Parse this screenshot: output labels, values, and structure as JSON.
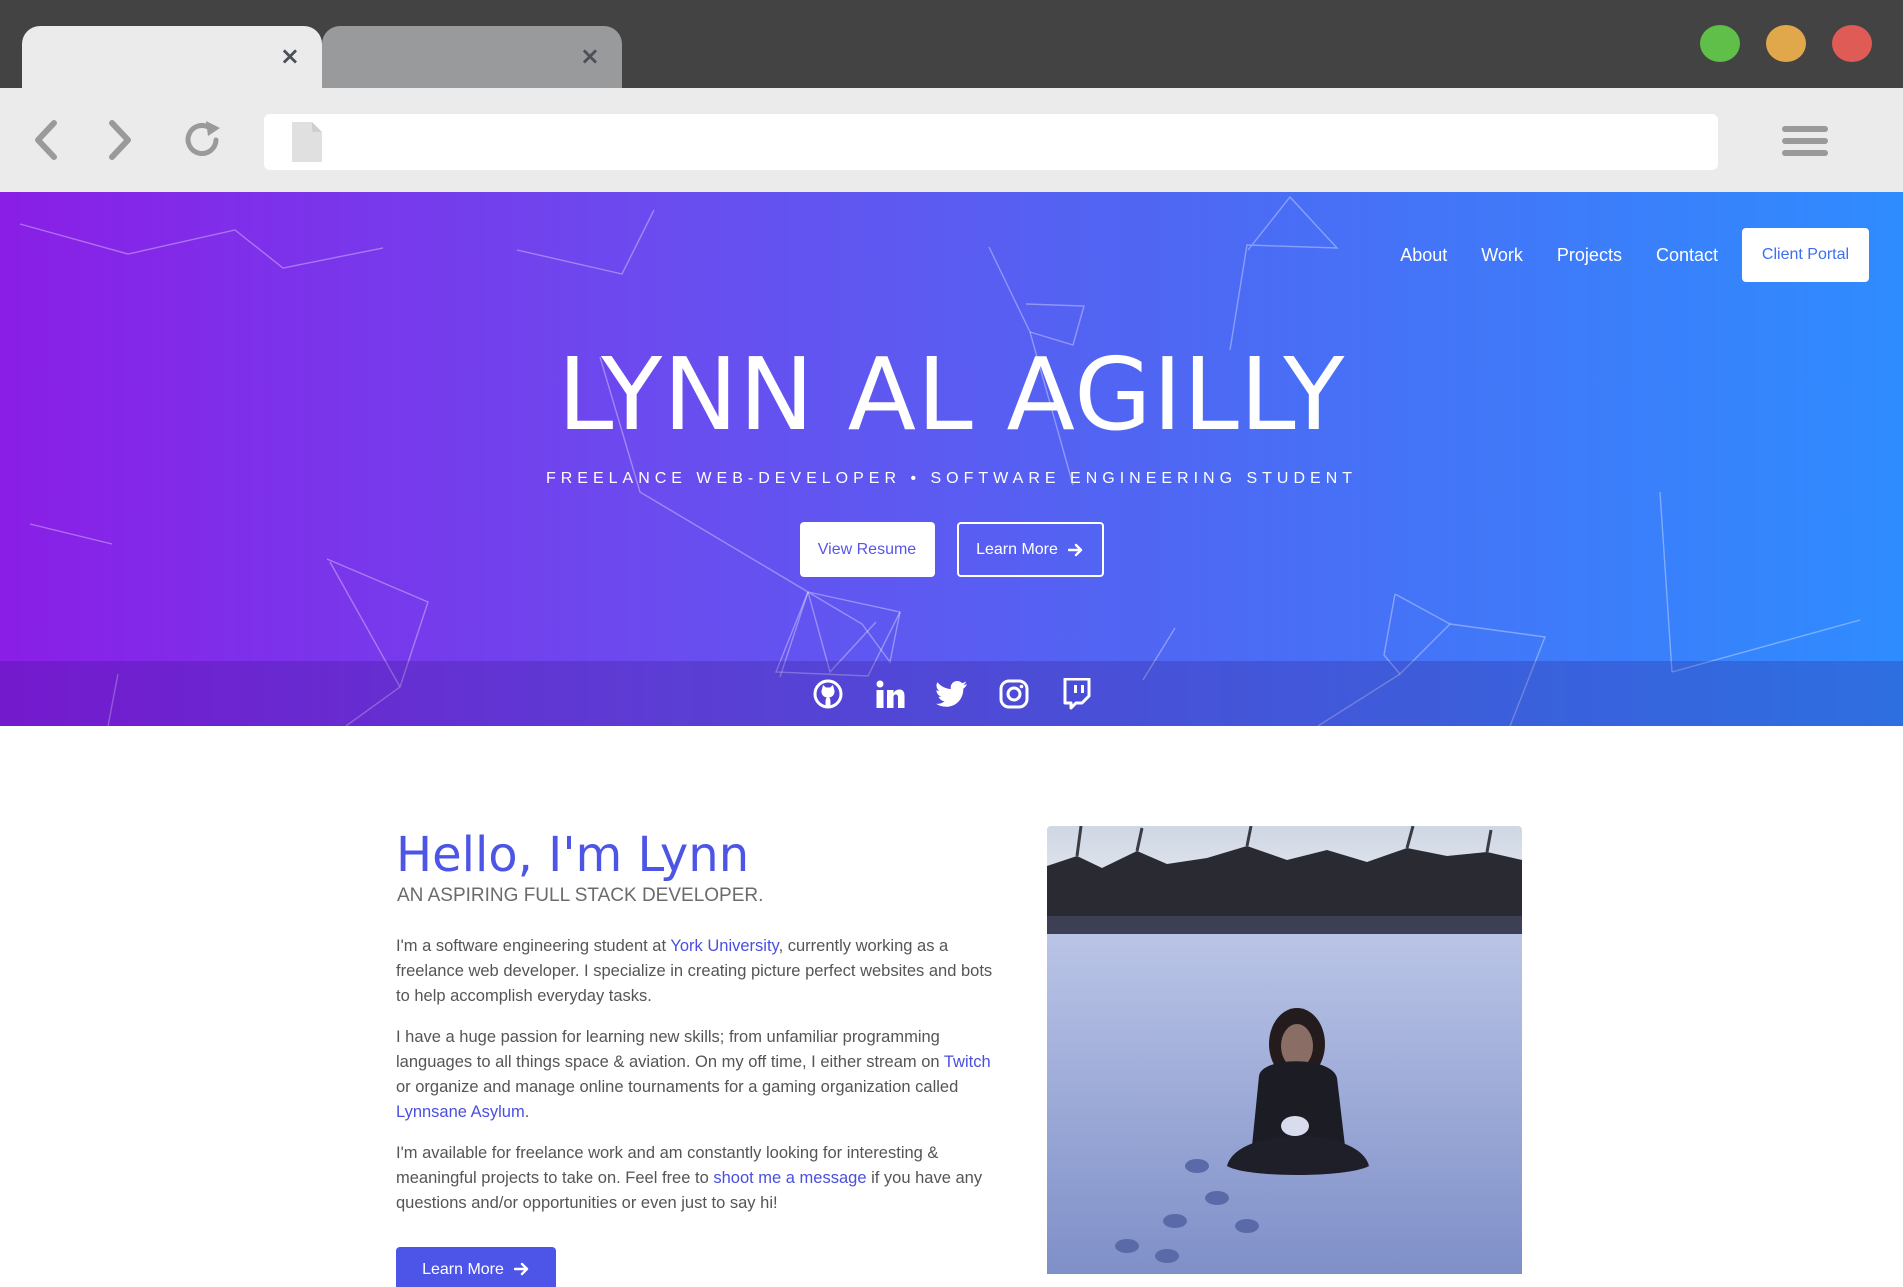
{
  "window": {
    "controls": [
      {
        "name": "maximize",
        "color": "#5fbf48"
      },
      {
        "name": "minimize",
        "color": "#e0a84a"
      },
      {
        "name": "close",
        "color": "#df5b55"
      }
    ]
  },
  "tabs": [
    {
      "state": "active",
      "close_icon": "×"
    },
    {
      "state": "inactive",
      "close_icon": "×"
    }
  ],
  "toolbar": {
    "back_icon": "chevron-left-icon",
    "forward_icon": "chevron-right-icon",
    "reload_icon": "reload-icon",
    "address_value": "",
    "menu_icon": "hamburger-icon"
  },
  "nav": {
    "links": [
      "About",
      "Work",
      "Projects",
      "Contact"
    ],
    "portal": "Client Portal"
  },
  "hero": {
    "title": "LYNN AL AGILLY",
    "subtitle": "FREELANCE WEB-DEVELOPER • SOFTWARE ENGINEERING STUDENT",
    "resume_button": "View Resume",
    "learn_button": "Learn More",
    "gradient": [
      "#8a1ee6",
      "#2f8cff"
    ]
  },
  "social": [
    "github-icon",
    "linkedin-icon",
    "twitter-icon",
    "instagram-icon",
    "twitch-icon"
  ],
  "about": {
    "heading": "Hello, I'm Lynn",
    "tagline": "AN ASPIRING FULL STACK DEVELOPER.",
    "p1": {
      "a": "I'm a software engineering student at ",
      "link": "York University",
      "b": ", currently working as a freelance web developer. I specialize in creating picture perfect websites and bots to help accomplish everyday tasks."
    },
    "p2": {
      "a": "I have a huge passion for learning new skills; from unfamiliar programming languages to all things space & aviation. On my off time, I either stream on ",
      "link1": "Twitch",
      "b": " or organize and manage online tournaments for a gaming organization called ",
      "link2": "Lynnsane Asylum",
      "c": "."
    },
    "p3": {
      "a": "I'm available for freelance work and am constantly looking for interesting & meaningful projects to take on. Feel free to ",
      "link": "shoot me a message",
      "b": " if you have any questions and/or opportunities or even just to say hi!"
    },
    "cta": "Learn More",
    "accent": "#4d55e6"
  }
}
